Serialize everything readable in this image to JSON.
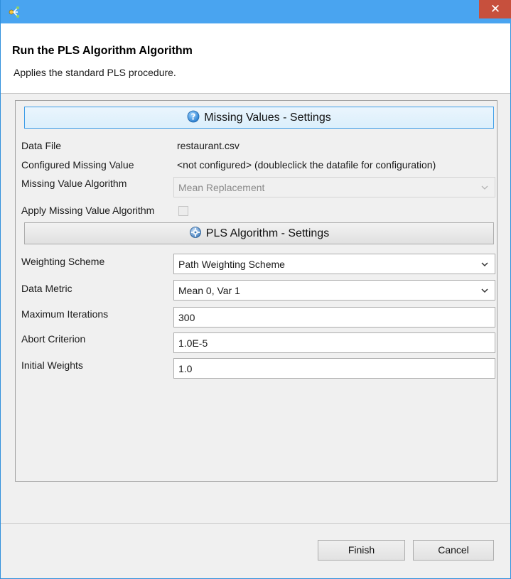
{
  "window": {
    "close_glyph": "✕"
  },
  "header": {
    "title": "Run the PLS Algorithm Algorithm",
    "description": "Applies the standard PLS procedure."
  },
  "missing_values": {
    "section_title": "Missing Values - Settings",
    "section_icon": "help-icon",
    "data_file_label": "Data File",
    "data_file_value": "restaurant.csv",
    "configured_label": "Configured Missing Value",
    "configured_value": "<not configured> (doubleclick the datafile for configuration)",
    "algorithm_label": "Missing Value Algorithm",
    "algorithm_value": "Mean Replacement",
    "apply_label": "Apply Missing Value Algorithm",
    "apply_checked": false
  },
  "pls": {
    "section_title": "PLS Algorithm - Settings",
    "section_icon": "gear-icon",
    "weighting_label": "Weighting Scheme",
    "weighting_value": "Path Weighting Scheme",
    "metric_label": "Data Metric",
    "metric_value": "Mean 0, Var 1",
    "max_iter_label": "Maximum Iterations",
    "max_iter_value": "300",
    "abort_label": "Abort Criterion",
    "abort_value": "1.0E-5",
    "init_weights_label": "Initial Weights",
    "init_weights_value": "1.0"
  },
  "footer": {
    "finish_label": "Finish",
    "cancel_label": "Cancel"
  },
  "colors": {
    "titlebar": "#49a4f0",
    "close": "#c7503d",
    "active_section_border": "#3c9de8"
  }
}
